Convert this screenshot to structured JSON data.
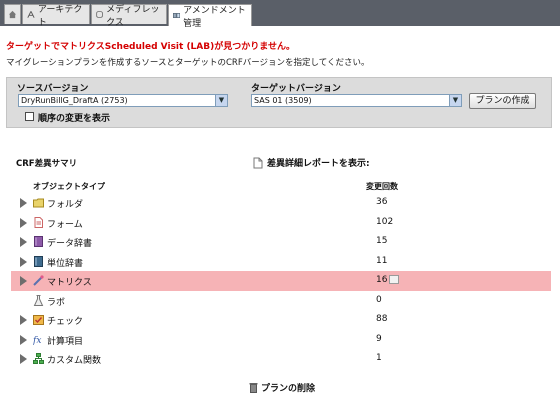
{
  "tabs": [
    {
      "label": "",
      "icon": "home-icon"
    },
    {
      "label": "アーキテクト",
      "icon": "architect-icon"
    },
    {
      "label": "メディフレックス",
      "icon": "mediflex-icon"
    },
    {
      "label": "アメンドメント管理",
      "icon": "amendment-icon",
      "active": true
    }
  ],
  "error_message": "ターゲットでマトリクスScheduled Visit (LAB)が見つかりません。",
  "instruction": "マイグレーションプランを作成するソースとターゲットのCRFバージョンを指定してください。",
  "source": {
    "label": "ソースバージョン",
    "value": "DryRunBillG_DraftA (2753)"
  },
  "target": {
    "label": "ターゲットバージョン",
    "value": "SAS 01 (3509)"
  },
  "create_plan_label": "プランの作成",
  "show_order_changes_label": "順序の変更を表示",
  "summary_title": "CRF差異サマリ",
  "detail_report_label": "差異詳細レポートを表示:",
  "columns": {
    "object_type": "オブジェクトタイプ",
    "change_count": "変更回数"
  },
  "rows": [
    {
      "label": "フォルダ",
      "count": "36",
      "icon": "folder-icon",
      "expandable": true
    },
    {
      "label": "フォーム",
      "count": "102",
      "icon": "form-icon",
      "expandable": true
    },
    {
      "label": "データ辞書",
      "count": "15",
      "icon": "data-dictionary-icon",
      "expandable": true
    },
    {
      "label": "単位辞書",
      "count": "11",
      "icon": "unit-dictionary-icon",
      "expandable": true
    },
    {
      "label": "マトリクス",
      "count": "16",
      "icon": "matrix-icon",
      "expandable": true,
      "highlighted": true
    },
    {
      "label": "ラボ",
      "count": "0",
      "icon": "lab-icon",
      "expandable": false
    },
    {
      "label": "チェック",
      "count": "88",
      "icon": "check-icon",
      "expandable": true
    },
    {
      "label": "計算項目",
      "count": "9",
      "icon": "derivation-icon",
      "expandable": true
    },
    {
      "label": "カスタム関数",
      "count": "1",
      "icon": "custom-function-icon",
      "expandable": true
    }
  ],
  "delete_plan_label": "プランの削除",
  "colors": {
    "error": "#d40000",
    "highlight_row": "#f6b3b6",
    "panel": "#dcdcdc",
    "tabbar": "#5a5f68"
  }
}
